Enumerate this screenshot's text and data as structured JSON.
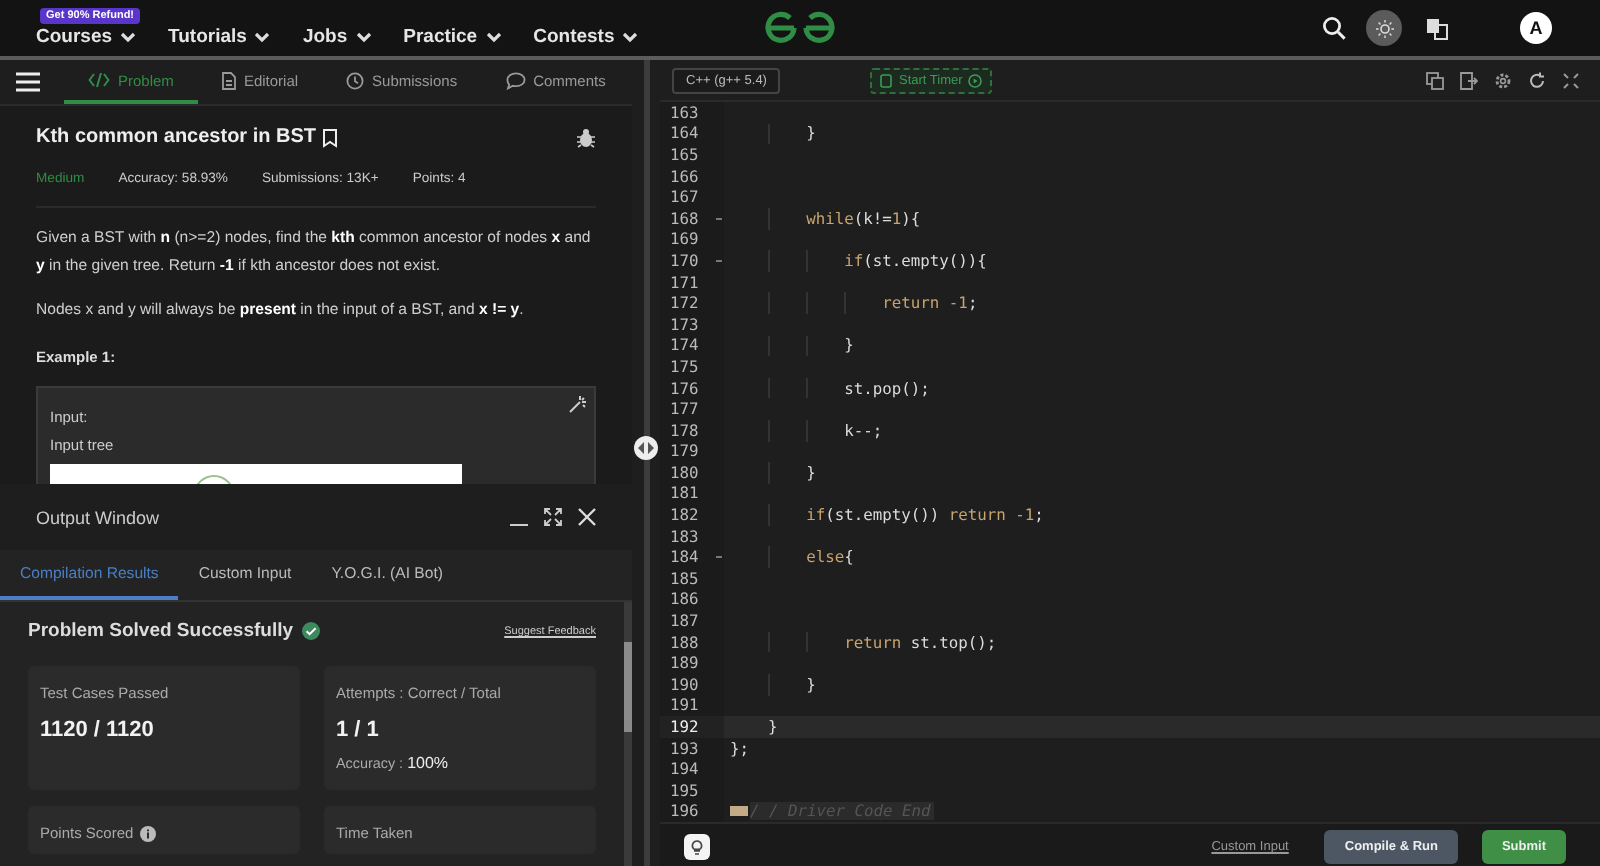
{
  "nav": {
    "badge": "Get 90% Refund!",
    "menu": [
      {
        "label": "Courses"
      },
      {
        "label": "Tutorials"
      },
      {
        "label": "Jobs"
      },
      {
        "label": "Practice"
      },
      {
        "label": "Contests"
      }
    ],
    "avatar": "A"
  },
  "problem_tabs": [
    {
      "label": "Problem",
      "selected": true
    },
    {
      "label": "Editorial",
      "selected": false
    },
    {
      "label": "Submissions",
      "selected": false
    },
    {
      "label": "Comments",
      "selected": false
    }
  ],
  "problem": {
    "title": "Kth common ancestor in BST",
    "difficulty": "Medium",
    "accuracy": "Accuracy: 58.93%",
    "submissions": "Submissions: 13K+",
    "points": "Points: 4",
    "paragraphs": [
      "Given a BST with **n** (n>=2) nodes, find the **kth** common ancestor of nodes **x** and **y** in the given tree. Return **-1** if kth ancestor does not exist.",
      "Nodes x and y will always be **present** in the input of a BST, and **x != y**."
    ],
    "example_heading": "Example 1:",
    "example_lines": [
      "Input:",
      "Input  tree"
    ]
  },
  "output_window": {
    "title": "Output Window",
    "tabs": [
      {
        "label": "Compilation Results",
        "selected": true
      },
      {
        "label": "Custom Input",
        "selected": false
      },
      {
        "label": "Y.O.G.I. (AI Bot)",
        "selected": false
      }
    ],
    "status": "Problem Solved Successfully",
    "feedback_link": "Suggest Feedback",
    "cards": [
      {
        "label": "Test Cases Passed",
        "value": "1120 / 1120",
        "info": false
      },
      {
        "label": "Attempts : Correct / Total",
        "value": "1 / 1",
        "note": "Accuracy : **100%**",
        "info": false
      },
      {
        "label": "Points Scored",
        "info": true
      },
      {
        "label": "Time Taken",
        "info": false
      }
    ]
  },
  "editor": {
    "language": "C++ (g++ 5.4)",
    "timer_button": "Start Timer",
    "lines": [
      {
        "n": "163",
        "foldable": false,
        "folded": false,
        "active": false
      },
      {
        "n": "164",
        "foldable": false,
        "folded": false,
        "active": false,
        "tokens": [
          {
            "t": "        }",
            "kind": "plain"
          }
        ]
      },
      {
        "n": "165",
        "foldable": false,
        "folded": false,
        "active": false
      },
      {
        "n": "166",
        "foldable": false,
        "folded": false,
        "active": false
      },
      {
        "n": "167",
        "foldable": false,
        "folded": false,
        "active": false
      },
      {
        "n": "168",
        "foldable": true,
        "folded": false,
        "active": false,
        "tokens": [
          {
            "t": "        while",
            "kind": "kw"
          },
          {
            "t": "(k!=",
            "kind": "plain"
          },
          {
            "t": "1",
            "kind": "num"
          },
          {
            "t": "){",
            "kind": "plain"
          }
        ]
      },
      {
        "n": "169",
        "foldable": false,
        "folded": false,
        "active": false
      },
      {
        "n": "170",
        "foldable": true,
        "folded": false,
        "active": false,
        "tokens": [
          {
            "t": "            if",
            "kind": "kw"
          },
          {
            "t": "(st.empty()){",
            "kind": "plain"
          }
        ]
      },
      {
        "n": "171",
        "foldable": false,
        "folded": false,
        "active": false
      },
      {
        "n": "172",
        "foldable": false,
        "folded": false,
        "active": false,
        "tokens": [
          {
            "t": "                return ",
            "kind": "kw"
          },
          {
            "t": "-1",
            "kind": "num"
          },
          {
            "t": ";",
            "kind": "plain"
          }
        ]
      },
      {
        "n": "173",
        "foldable": false,
        "folded": false,
        "active": false
      },
      {
        "n": "174",
        "foldable": false,
        "folded": false,
        "active": false,
        "tokens": [
          {
            "t": "            }",
            "kind": "plain"
          }
        ]
      },
      {
        "n": "175",
        "foldable": false,
        "folded": false,
        "active": false
      },
      {
        "n": "176",
        "foldable": false,
        "folded": false,
        "active": false,
        "tokens": [
          {
            "t": "            st.pop();",
            "kind": "plain"
          }
        ]
      },
      {
        "n": "177",
        "foldable": false,
        "folded": false,
        "active": false
      },
      {
        "n": "178",
        "foldable": false,
        "folded": false,
        "active": false,
        "tokens": [
          {
            "t": "            k--;",
            "kind": "plain"
          }
        ]
      },
      {
        "n": "179",
        "foldable": false,
        "folded": false,
        "active": false
      },
      {
        "n": "180",
        "foldable": false,
        "folded": false,
        "active": false,
        "tokens": [
          {
            "t": "        }",
            "kind": "plain"
          }
        ]
      },
      {
        "n": "181",
        "foldable": false,
        "folded": false,
        "active": false
      },
      {
        "n": "182",
        "foldable": false,
        "folded": false,
        "active": false,
        "tokens": [
          {
            "t": "        if",
            "kind": "kw"
          },
          {
            "t": "(st.empty()) ",
            "kind": "plain"
          },
          {
            "t": "return ",
            "kind": "kw"
          },
          {
            "t": "-1",
            "kind": "num"
          },
          {
            "t": ";",
            "kind": "plain"
          }
        ]
      },
      {
        "n": "183",
        "foldable": false,
        "folded": false,
        "active": false
      },
      {
        "n": "184",
        "foldable": true,
        "folded": false,
        "active": false,
        "tokens": [
          {
            "t": "        else",
            "kind": "kw"
          },
          {
            "t": "{",
            "kind": "plain"
          }
        ]
      },
      {
        "n": "185",
        "foldable": false,
        "folded": false,
        "active": false
      },
      {
        "n": "186",
        "foldable": false,
        "folded": false,
        "active": false
      },
      {
        "n": "187",
        "foldable": false,
        "folded": false,
        "active": false
      },
      {
        "n": "188",
        "foldable": false,
        "folded": false,
        "active": false,
        "tokens": [
          {
            "t": "            return ",
            "kind": "kw"
          },
          {
            "t": "st.top();",
            "kind": "plain"
          }
        ]
      },
      {
        "n": "189",
        "foldable": false,
        "folded": false,
        "active": false
      },
      {
        "n": "190",
        "foldable": false,
        "folded": false,
        "active": false,
        "tokens": [
          {
            "t": "        }",
            "kind": "plain"
          }
        ]
      },
      {
        "n": "191",
        "foldable": false,
        "folded": false,
        "active": false
      },
      {
        "n": "192",
        "foldable": false,
        "folded": false,
        "active": true,
        "tokens": [
          {
            "t": "    }",
            "kind": "plain"
          }
        ]
      },
      {
        "n": "193",
        "foldable": false,
        "folded": false,
        "active": false,
        "tokens": [
          {
            "t": "};",
            "kind": "plain"
          }
        ]
      },
      {
        "n": "194",
        "foldable": false,
        "folded": false,
        "active": false
      },
      {
        "n": "195",
        "foldable": false,
        "folded": false,
        "active": false
      },
      {
        "n": "196",
        "foldable": false,
        "folded": true,
        "active": false,
        "tokens": [
          {
            "t": "/ / Driver Code End",
            "kind": "comment"
          }
        ]
      }
    ]
  },
  "footer": {
    "custom_input": "Custom Input",
    "compile": "Compile & Run",
    "submit": "Submit"
  }
}
